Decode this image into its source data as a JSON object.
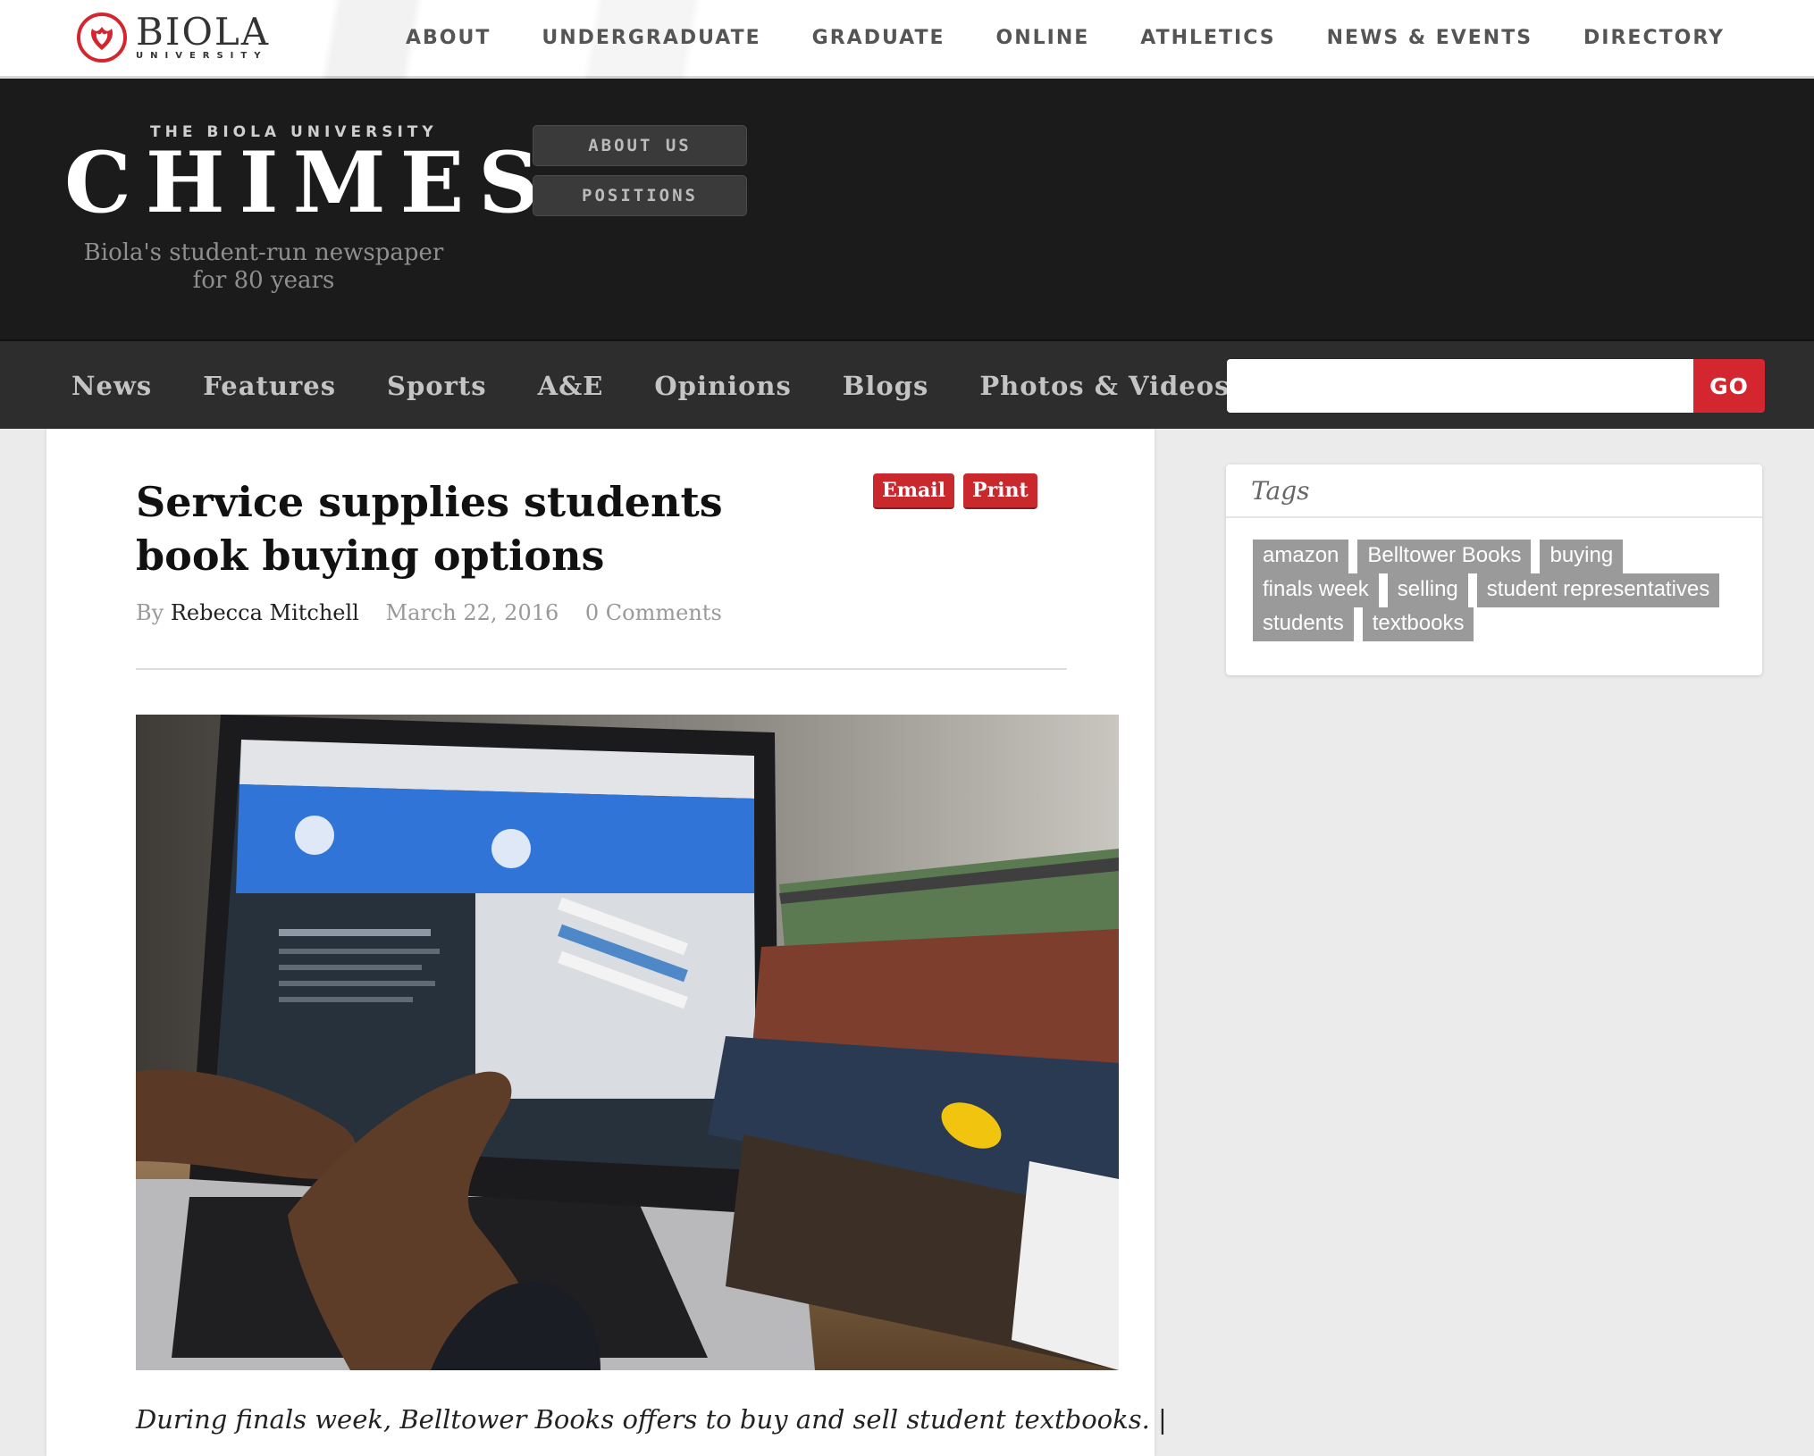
{
  "university": {
    "logo_main": "BIOLA",
    "logo_sub": "UNIVERSITY",
    "nav": [
      "ABOUT",
      "UNDERGRADUATE",
      "GRADUATE",
      "ONLINE",
      "ATHLETICS",
      "NEWS & EVENTS",
      "DIRECTORY"
    ]
  },
  "masthead": {
    "pretitle": "THE BIOLA UNIVERSITY",
    "title": "CHIMES",
    "tagline": "Biola's student-run newspaper for 80 years",
    "buttons": [
      "ABOUT US",
      "POSITIONS"
    ]
  },
  "sections": {
    "items": [
      "News",
      "Features",
      "Sports",
      "A&E",
      "Opinions",
      "Blogs",
      "Photos & Videos"
    ],
    "search_placeholder": "",
    "search_button": "GO"
  },
  "article": {
    "headline": "Service supplies students book buying options",
    "actions": [
      "Email",
      "Print"
    ],
    "by": "By",
    "author": "Rebecca Mitchell",
    "date": "March 22, 2016",
    "comments": "0 Comments",
    "caption": "During finals week, Belltower Books offers to buy and sell student textbooks.  |"
  },
  "sidebar": {
    "tags_title": "Tags",
    "tags": [
      "amazon",
      "Belltower Books",
      "buying",
      "finals week",
      "selling",
      "student representatives",
      "students",
      "textbooks"
    ]
  },
  "colors": {
    "accent_red": "#d3262e",
    "masthead_bg": "#1b1b1b",
    "nav_bg": "#2d2d2d",
    "tag_bg": "#9a9a9a"
  }
}
